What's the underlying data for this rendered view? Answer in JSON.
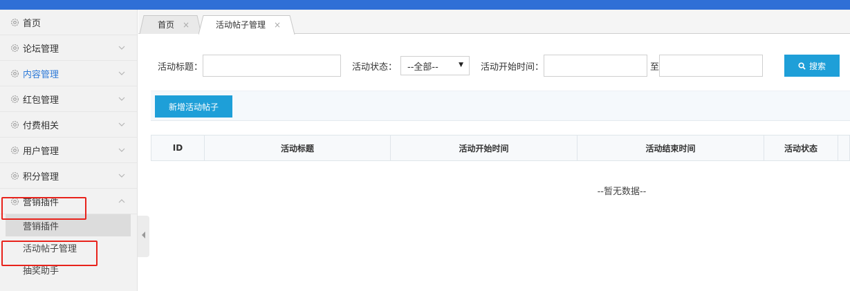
{
  "sidebar": {
    "items": [
      {
        "label": "首页",
        "has_chevron": false
      },
      {
        "label": "论坛管理",
        "has_chevron": true
      },
      {
        "label": "内容管理",
        "has_chevron": true,
        "active": true
      },
      {
        "label": "红包管理",
        "has_chevron": true
      },
      {
        "label": "付费相关",
        "has_chevron": true
      },
      {
        "label": "用户管理",
        "has_chevron": true
      },
      {
        "label": "积分管理",
        "has_chevron": true
      },
      {
        "label": "营销插件",
        "has_chevron": true,
        "expanded": true
      }
    ],
    "sub_items": [
      {
        "label": "营销插件",
        "selected": true
      },
      {
        "label": "活动帖子管理"
      },
      {
        "label": "抽奖助手"
      }
    ]
  },
  "tabs": [
    {
      "label": "首页",
      "close": "×"
    },
    {
      "label": "活动帖子管理",
      "close": "×",
      "active": true
    }
  ],
  "filters": {
    "title_label": "活动标题：",
    "title_value": "",
    "status_label": "活动状态：",
    "status_value": "--全部--",
    "start_label": "活动开始时间：",
    "start_from": "",
    "range_sep": "至",
    "start_to": "",
    "search_label": "搜索"
  },
  "toolbar": {
    "add_label": "新增活动帖子"
  },
  "table": {
    "columns": [
      "ID",
      "活动标题",
      "活动开始时间",
      "活动结束时间",
      "活动状态"
    ],
    "empty_text": "--暂无数据--"
  },
  "colors": {
    "accent": "#1e9fd8",
    "topbar": "#2f6fd6",
    "active_text": "#2d7ad8",
    "highlight": "#e8221b"
  }
}
